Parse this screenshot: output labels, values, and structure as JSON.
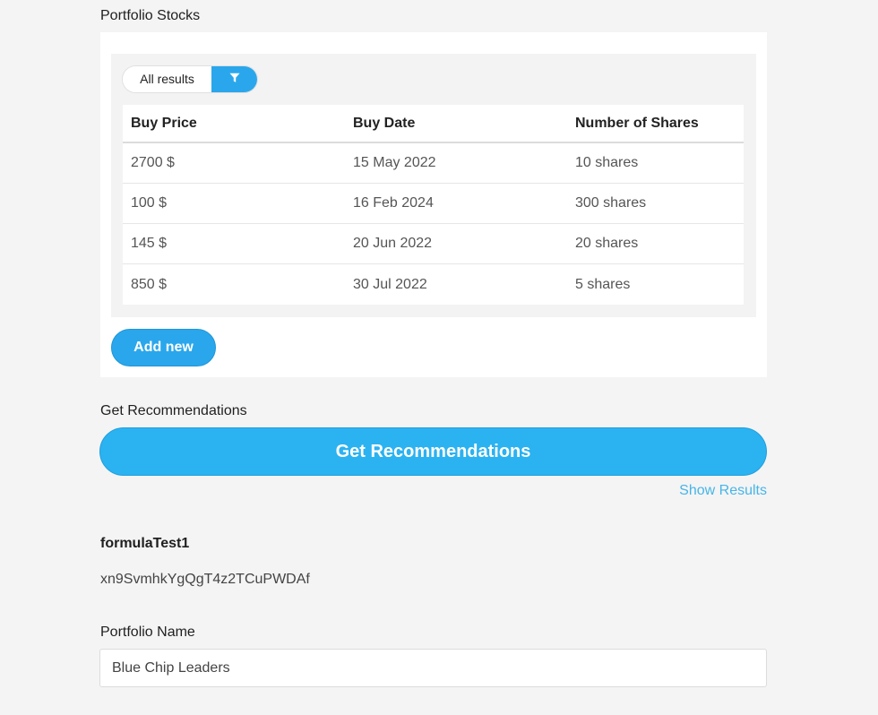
{
  "portfolio_stocks": {
    "label": "Portfolio Stocks",
    "filter": {
      "all_results_label": "All results",
      "filter_icon": "filter-funnel-icon"
    },
    "table": {
      "headers": [
        "Buy Price",
        "Buy Date",
        "Number of Shares"
      ],
      "rows": [
        [
          "2700 $",
          "15 May 2022",
          "10 shares"
        ],
        [
          "100 $",
          "16 Feb 2024",
          "300 shares"
        ],
        [
          "145 $",
          "20 Jun 2022",
          "20 shares"
        ],
        [
          "850 $",
          "30 Jul 2022",
          "5 shares"
        ]
      ]
    },
    "add_new_label": "Add new"
  },
  "recommendations": {
    "label": "Get Recommendations",
    "button_label": "Get Recommendations",
    "show_results_label": "Show Results"
  },
  "formula": {
    "title": "formulaTest1",
    "value": "xn9SvmhkYgQgT4z2TCuPWDAf"
  },
  "portfolio_name": {
    "label": "Portfolio Name",
    "value": "Blue Chip Leaders"
  },
  "colors": {
    "accent": "#2aa7ec",
    "primary_button": "#2bb2f1",
    "link": "#46b5e8",
    "background": "#f4f4f4"
  }
}
